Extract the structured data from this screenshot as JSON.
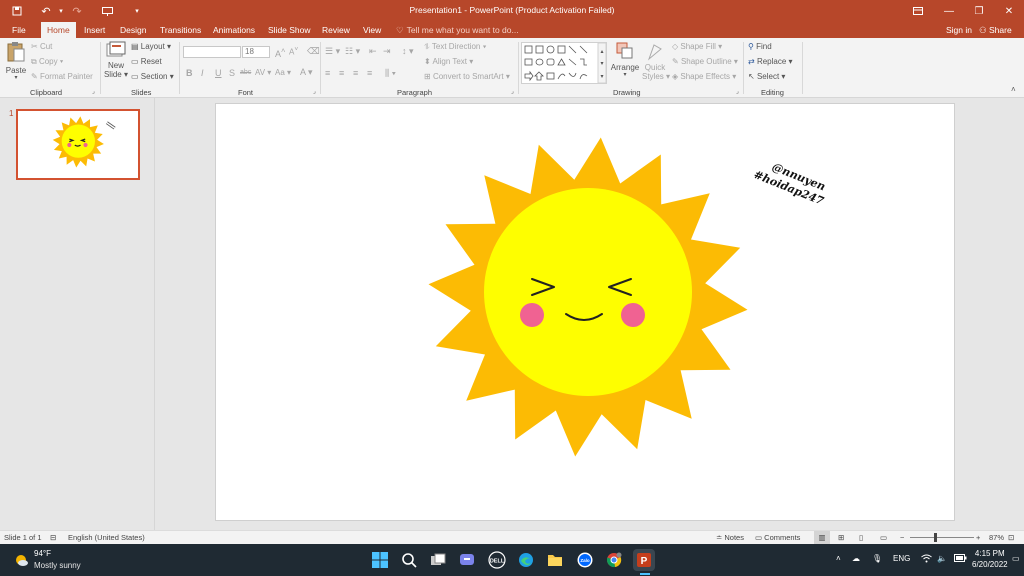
{
  "window": {
    "title": "Presentation1 - PowerPoint (Product Activation Failed)"
  },
  "tabs": [
    "File",
    "Home",
    "Insert",
    "Design",
    "Transitions",
    "Animations",
    "Slide Show",
    "Review",
    "View"
  ],
  "tell_me": "Tell me what you want to do...",
  "sign_in": "Sign in",
  "share": "Share",
  "ribbon": {
    "clipboard": {
      "paste": "Paste",
      "cut": "Cut",
      "copy": "Copy",
      "format_painter": "Format Painter",
      "label": "Clipboard"
    },
    "slides": {
      "new_slide_1": "New",
      "new_slide_2": "Slide",
      "layout": "Layout",
      "reset": "Reset",
      "section": "Section",
      "label": "Slides"
    },
    "font": {
      "size": "18",
      "label": "Font"
    },
    "paragraph": {
      "text_direction": "Text Direction",
      "align_text": "Align Text",
      "convert_smartart": "Convert to SmartArt",
      "label": "Paragraph"
    },
    "drawing": {
      "arrange": "Arrange",
      "quick_styles_1": "Quick",
      "quick_styles_2": "Styles",
      "shape_fill": "Shape Fill",
      "shape_outline": "Shape Outline",
      "shape_effects": "Shape Effects",
      "label": "Drawing"
    },
    "editing": {
      "find": "Find",
      "replace": "Replace",
      "select": "Select",
      "label": "Editing"
    }
  },
  "thumbnail": {
    "number": "1"
  },
  "slide": {
    "watermark_line1": "@nnuyen",
    "watermark_line2": "#hoidap247"
  },
  "status": {
    "slide_of": "Slide 1 of 1",
    "language": "English (United States)",
    "notes": "Notes",
    "comments": "Comments",
    "zoom": "87%"
  },
  "taskbar": {
    "temperature": "94°F",
    "weather": "Mostly sunny",
    "lang": "ENG",
    "time": "4:15 PM",
    "date": "6/20/2022"
  },
  "colors": {
    "accent": "#b7472a",
    "sun_rays": "#fcbb04",
    "sun_face": "#fefe00",
    "cheeks": "#f06292"
  }
}
